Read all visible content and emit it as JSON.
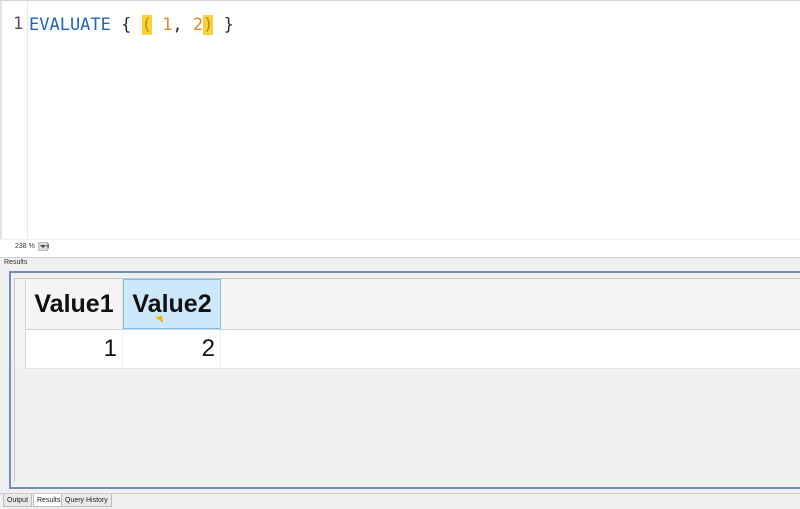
{
  "editor": {
    "line_number": "1",
    "code": {
      "keyword": "EVALUATE",
      "open_brace": "{",
      "open_paren": "(",
      "value1": "1",
      "comma": ",",
      "value2": "2",
      "close_paren": ")",
      "close_brace": "}"
    },
    "zoom_level": "238 %"
  },
  "results": {
    "caption": "Results",
    "columns": [
      "Value1",
      "Value2"
    ],
    "rows": [
      [
        "1",
        "2"
      ]
    ]
  },
  "tabs": {
    "output": "Output",
    "results": "Results",
    "query_history": "Query History",
    "active": "Results"
  }
}
